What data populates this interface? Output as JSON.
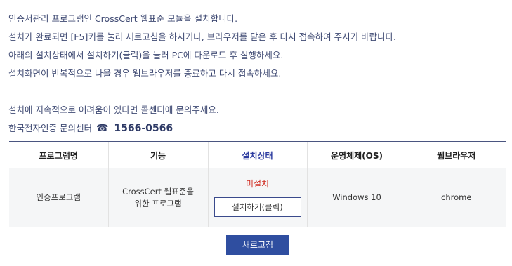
{
  "intro": {
    "lines": [
      "인증서관리 프로그램인 CrossCert 웹표준 모듈을 설치합니다.",
      "설치가 완료되면 [F5]키를 눌러 새로고침을 하시거나, 브라우저를 닫은 후 다시 접속하여 주시기 바랍니다.",
      "아래의 설치상태에서 설치하기(클릭)을 눌러 PC에 다운로드 후 실행하세요.",
      "설치화면이 반복적으로 나올 경우 웹브라우저를 종료하고 다시 접속하세요."
    ],
    "support_notice": "설치에 지속적으로 어려움이 있다면 콜센터에 문의주세요.",
    "support_center_label": "한국전자인증 문의센터",
    "support_phone": "1566-0566",
    "phone_icon": "telephone-icon"
  },
  "table": {
    "headers": [
      "프로그램명",
      "기능",
      "설치상태",
      "운영체제(OS)",
      "웹브라우저"
    ],
    "row": {
      "program": "인증프로그램",
      "function_line1": "CrossCert 웹표준을",
      "function_line2": "위한 프로그램",
      "status": "미설치",
      "install_button": "설치하기(클릭)",
      "os": "Windows 10",
      "browser": "chrome"
    }
  },
  "refresh_button": "새로고침",
  "colors": {
    "text": "#3f4a73",
    "accent_header": "#2d3ca0",
    "status_red": "#d02b20",
    "button_blue": "#2f4ea0"
  }
}
